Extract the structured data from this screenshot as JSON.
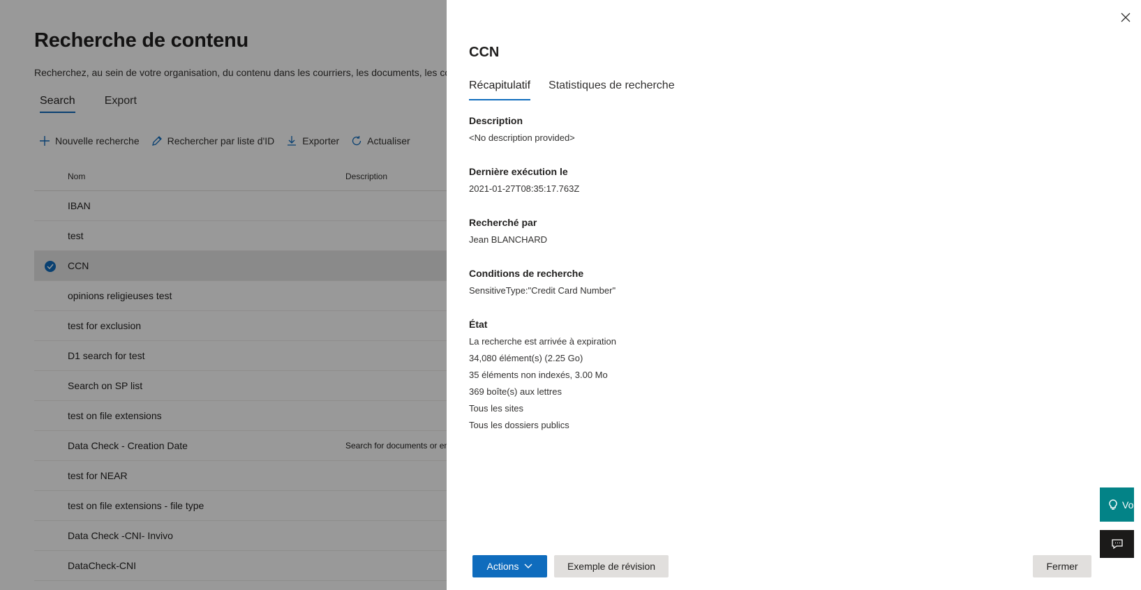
{
  "page": {
    "title": "Recherche de contenu",
    "description": "Recherchez, au sein de votre organisation, du contenu dans les courriers, les documents, les conv",
    "tabs": [
      "Search",
      "Export"
    ],
    "toolbar": {
      "new_search": "Nouvelle recherche",
      "search_by_id": "Rechercher par liste d'ID",
      "export": "Exporter",
      "refresh": "Actualiser"
    },
    "table": {
      "columns": {
        "name": "Nom",
        "description": "Description"
      },
      "rows": [
        {
          "name": "IBAN",
          "description": ""
        },
        {
          "name": "test",
          "description": ""
        },
        {
          "name": "CCN",
          "description": ""
        },
        {
          "name": "opinions religieuses test",
          "description": ""
        },
        {
          "name": "test for exclusion",
          "description": ""
        },
        {
          "name": "D1 search for test",
          "description": ""
        },
        {
          "name": "Search on SP list",
          "description": ""
        },
        {
          "name": "test on file extensions",
          "description": ""
        },
        {
          "name": "Data Check - Creation Date",
          "description": "Search for documents or en"
        },
        {
          "name": "test for NEAR",
          "description": ""
        },
        {
          "name": "test on file extensions - file type",
          "description": ""
        },
        {
          "name": "Data Check -CNI- Invivo",
          "description": ""
        },
        {
          "name": "DataCheck-CNI",
          "description": ""
        }
      ],
      "selected_index": 2
    }
  },
  "panel": {
    "title": "CCN",
    "tabs": [
      "Récapitulatif",
      "Statistiques de recherche"
    ],
    "fields": {
      "description_label": "Description",
      "description_value": "<No description provided>",
      "last_run_label": "Dernière exécution le",
      "last_run_value": "2021-01-27T08:35:17.763Z",
      "searched_by_label": "Recherché par",
      "searched_by_value": "Jean BLANCHARD",
      "conditions_label": "Conditions de recherche",
      "conditions_value": "SensitiveType:\"Credit Card Number\"",
      "status_label": "État",
      "status_lines": [
        "La recherche est arrivée à expiration",
        "34,080 élément(s) (2.25 Go)",
        "35 éléments non indexés, 3.00 Mo",
        "369 boîte(s) aux lettres",
        "Tous les sites",
        "Tous les dossiers publics"
      ]
    },
    "buttons": {
      "actions": "Actions",
      "sample": "Exemple de révision",
      "close": "Fermer"
    }
  },
  "side": {
    "teal_label": "Vo"
  },
  "colors": {
    "accent": "#0f6cbd",
    "teal": "#038387"
  }
}
